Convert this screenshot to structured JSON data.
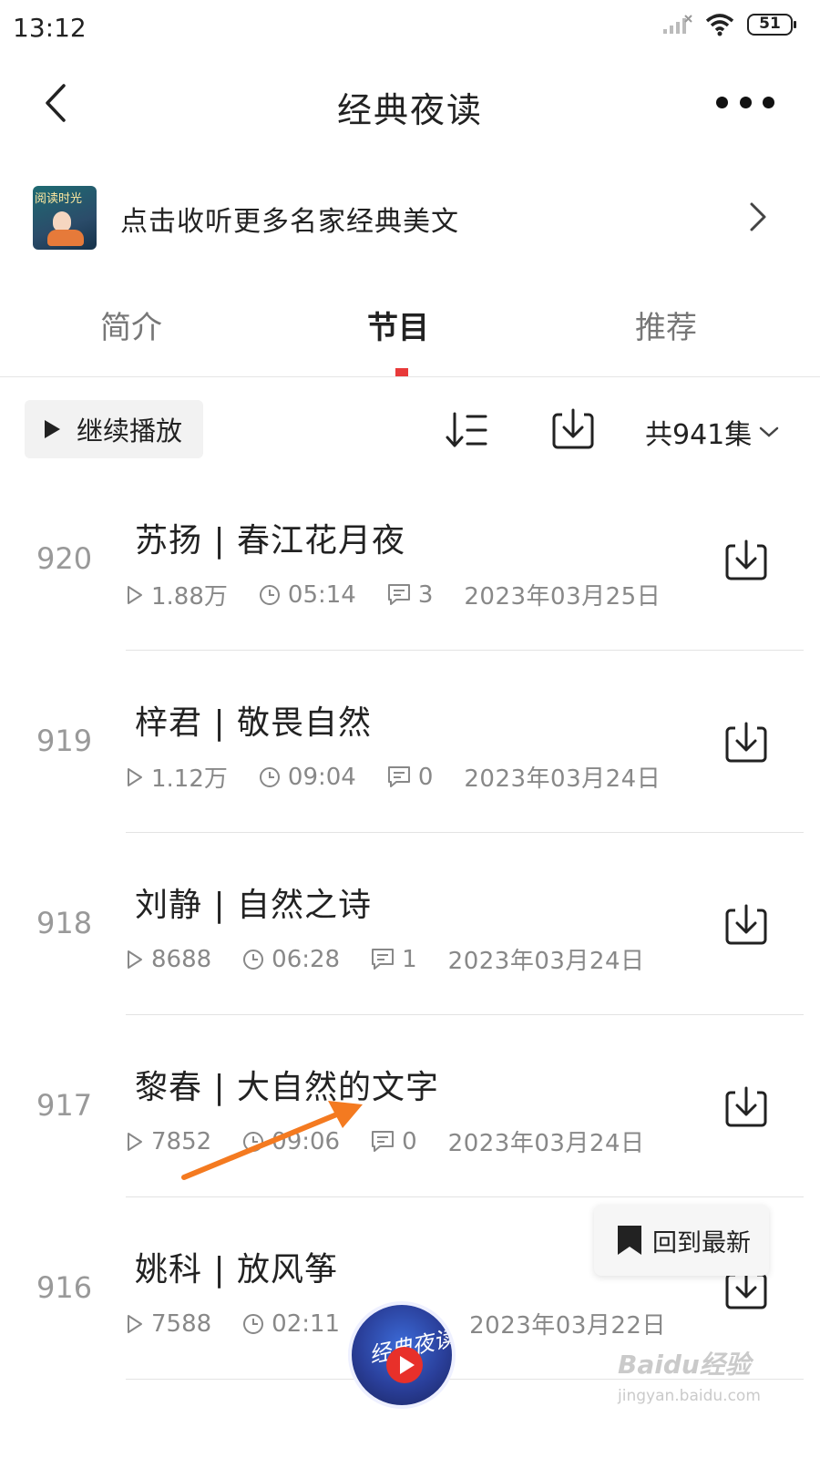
{
  "status_bar": {
    "time": "13:12",
    "battery": "51"
  },
  "nav": {
    "title": "经典夜读"
  },
  "promo": {
    "text": "点击收听更多名家经典美文",
    "thumb_text": "阅读时光"
  },
  "tabs": [
    {
      "label": "简介",
      "active": false
    },
    {
      "label": "节目",
      "active": true
    },
    {
      "label": "推荐",
      "active": false
    }
  ],
  "toolbar": {
    "continue_label": "继续播放",
    "count_label": "共941集"
  },
  "episodes": [
    {
      "number": "920",
      "title": "苏扬 | 春江花月夜",
      "plays": "1.88万",
      "duration": "05:14",
      "comments": "3",
      "date": "2023年03月25日"
    },
    {
      "number": "919",
      "title": "梓君 | 敬畏自然",
      "plays": "1.12万",
      "duration": "09:04",
      "comments": "0",
      "date": "2023年03月24日"
    },
    {
      "number": "918",
      "title": "刘静 | 自然之诗",
      "plays": "8688",
      "duration": "06:28",
      "comments": "1",
      "date": "2023年03月24日"
    },
    {
      "number": "917",
      "title": "黎春 | 大自然的文字",
      "plays": "7852",
      "duration": "09:06",
      "comments": "0",
      "date": "2023年03月24日"
    },
    {
      "number": "916",
      "title": "姚科 | 放风筝",
      "plays": "7588",
      "duration": "02:11",
      "comments": "",
      "date": "2023年03月22日"
    }
  ],
  "floating": {
    "back_to_latest": "回到最新"
  },
  "mini_player": {
    "cover_text": "经典夜读"
  },
  "watermark": {
    "brand": "Baidu经验",
    "url": "jingyan.baidu.com"
  },
  "colors": {
    "accent": "#e83a3a",
    "annotation": "#f47a20"
  }
}
